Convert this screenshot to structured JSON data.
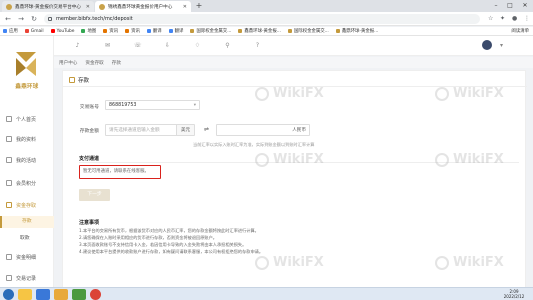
{
  "browser": {
    "tabs": [
      {
        "label": "鑫鼎环球-黄金报价交易平台中心"
      },
      {
        "label": "锦绣鑫鼎环球黄金报价用户中心"
      }
    ],
    "url": "member.bibfx.tech/mc/deposit",
    "bookmarks": [
      "应用",
      "Gmail",
      "YouTube",
      "地图",
      "资讯",
      "资讯",
      "翻译",
      "翻译",
      "国际权金金属交...",
      "鑫鼎环球-黄金报...",
      "国际权金金属交...",
      "鑫鼎环球-黄金报..."
    ],
    "reading_list": "阅读清单"
  },
  "sidebar": {
    "logo_text": "鑫鼎环球",
    "items": [
      {
        "label": "个人首页"
      },
      {
        "label": "我的资料"
      },
      {
        "label": "我的活动"
      },
      {
        "label": "会员积分"
      },
      {
        "label": "资金存取"
      }
    ],
    "subitems": [
      {
        "label": "存款"
      },
      {
        "label": "取款"
      }
    ],
    "items_after": [
      {
        "label": "资金明细"
      },
      {
        "label": "交易记录"
      }
    ]
  },
  "breadcrumb": [
    "用户中心",
    "资金存取",
    "存款"
  ],
  "page": {
    "title": "存款",
    "account_label": "交易账号",
    "account_value": "868819753",
    "amount_label": "存款金额",
    "amount_placeholder": "请先选择通道后输入金额",
    "amount_unit": "美元",
    "rmb_unit": "人民币",
    "rate_hint": "当前汇率以实际入账时汇率为准，实际到账金额以到账时汇率计算",
    "channel_title": "支付通道",
    "channel_alert": "暂无可用通道，请联系在线客服。",
    "next_button": "下一步",
    "notes_title": "注意事项",
    "notes": [
      "1.本平台的交易所有货币，根据该货币对应的人民币汇率，您的存款金额将按此时汇率进行计算。",
      "2.请您确保在入账时采用相应的货币进行存款，否则资金将被退回原账户。",
      "3.本页面收款账号不支持信用卡入金，若因信用卡导致的入金失败将由本人承担相关损失。",
      "4.建议使用本平台提供的收款账户进行存款，如有疑问请联系客服，本公司有权拒绝您的存款申请。"
    ]
  },
  "watermark": "WikiFX",
  "taskbar": {
    "time": "2:09",
    "date": "2022/2/12"
  }
}
